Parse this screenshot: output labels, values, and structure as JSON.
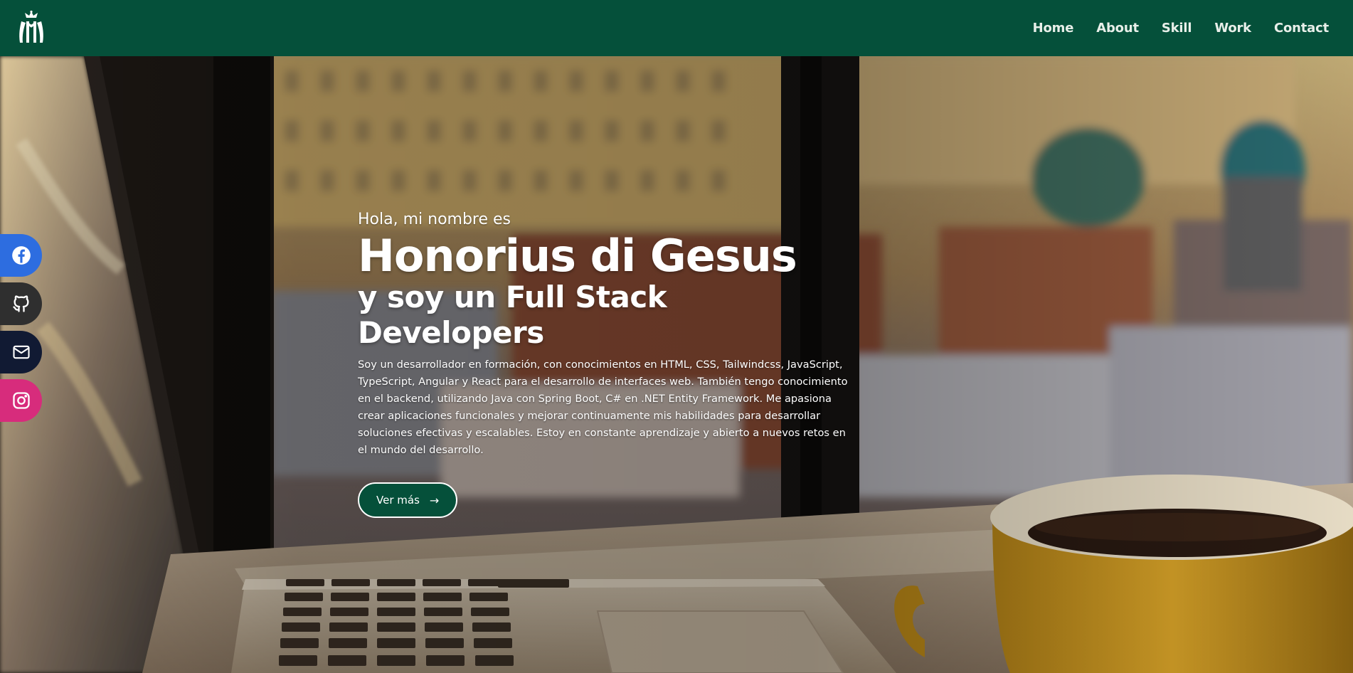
{
  "nav": {
    "logo_icon": "crown-logo-icon",
    "links": [
      {
        "label": "Home"
      },
      {
        "label": "About"
      },
      {
        "label": "Skill"
      },
      {
        "label": "Work"
      },
      {
        "label": "Contact"
      }
    ]
  },
  "hero": {
    "greeting": "Hola, mi nombre es",
    "name": "Honorius di Gesus",
    "role": "y soy un Full Stack Developers",
    "bio": "Soy un desarrollador en formación, con conocimientos en HTML, CSS, Tailwindcss, JavaScript, TypeScript, Angular y React para el desarrollo de interfaces web. También tengo conocimiento en el backend, utilizando Java con Spring Boot, C# en .NET Entity Framework. Me apasiona crear aplicaciones funcionales y mejorar continuamente mis habilidades para desarrollar soluciones efectivas y escalables. Estoy en constante aprendizaje y abierto a nuevos retos en el mundo del desarrollo.",
    "cta_label": "Ver más",
    "cta_icon": "arrow-right-icon"
  },
  "social": [
    {
      "icon": "facebook-icon",
      "color": "#2d6de0"
    },
    {
      "icon": "github-icon",
      "color": "#2f2f2f"
    },
    {
      "icon": "mail-icon",
      "color": "#111a33"
    },
    {
      "icon": "instagram-icon",
      "color": "#d72c7c"
    }
  ],
  "colors": {
    "brand_green": "#05503a",
    "text_light": "#ffffff"
  }
}
